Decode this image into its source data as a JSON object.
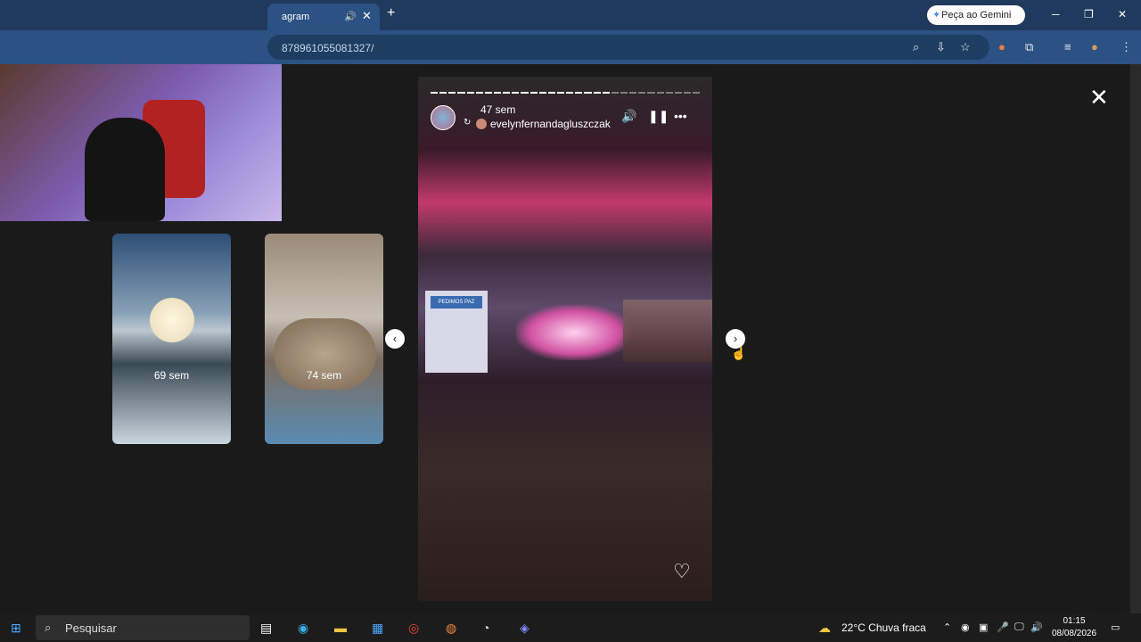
{
  "browser": {
    "tab_title": "agram",
    "tab_audio_icon": "speaker-icon",
    "tab_close": "✕",
    "new_tab": "+",
    "gemini_label": "Peça ao Gemini",
    "url": "878961055081327/",
    "window_controls": {
      "minimize": "─",
      "restore": "❐",
      "close": "✕"
    }
  },
  "viewer": {
    "close_label": "✕",
    "prev_thumbs": [
      {
        "label": "69 sem"
      },
      {
        "label": "74 sem"
      }
    ],
    "prev_arrow": "‹",
    "next_arrow": "›",
    "story": {
      "time": "47 sem",
      "username": "evelynfernandagluszczak",
      "repost_icon": "↻",
      "sign_text": "PEDIMOS PAZ",
      "progress_total": 30,
      "progress_done": 20
    }
  },
  "taskbar": {
    "search_placeholder": "Pesquisar",
    "weather": "22°C  Chuva fraca",
    "time": "01:15",
    "date": "08/08/2026"
  }
}
